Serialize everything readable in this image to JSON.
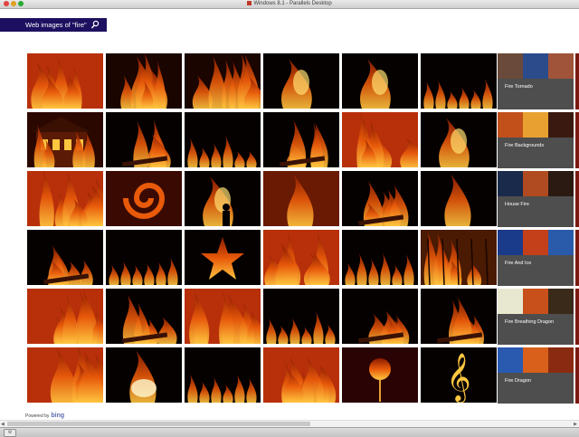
{
  "window": {
    "title": "Windows 8.1 - Parallels Desktop"
  },
  "search": {
    "query_label": "Web images of \"fire\""
  },
  "results": {
    "images": [
      {
        "theme": "flames-wide"
      },
      {
        "theme": "flame-burst"
      },
      {
        "theme": "flame-cloud"
      },
      {
        "theme": "fire-figure"
      },
      {
        "theme": "fire-hand"
      },
      {
        "theme": "flame-row"
      },
      {
        "theme": "house-fire"
      },
      {
        "theme": "bonfire-dark"
      },
      {
        "theme": "flame-row"
      },
      {
        "theme": "logs"
      },
      {
        "theme": "flames-wide"
      },
      {
        "theme": "fire-woman"
      },
      {
        "theme": "flames-wide"
      },
      {
        "theme": "swirl"
      },
      {
        "theme": "silhouette"
      },
      {
        "theme": "single-flame"
      },
      {
        "theme": "fireplace"
      },
      {
        "theme": "tall-flame"
      },
      {
        "theme": "campfire"
      },
      {
        "theme": "flame-row"
      },
      {
        "theme": "fire-star"
      },
      {
        "theme": "flames-wide"
      },
      {
        "theme": "flame-black"
      },
      {
        "theme": "forest-fire"
      },
      {
        "theme": "flames-wide"
      },
      {
        "theme": "embers"
      },
      {
        "theme": "flames-wide"
      },
      {
        "theme": "flame-low"
      },
      {
        "theme": "bonfire-dark"
      },
      {
        "theme": "embers"
      },
      {
        "theme": "flames-wide"
      },
      {
        "theme": "white-flame"
      },
      {
        "theme": "flame-low"
      },
      {
        "theme": "flames-wide"
      },
      {
        "theme": "fire-rose"
      },
      {
        "theme": "treble-clef"
      }
    ],
    "related": [
      {
        "label": "Fire Tornado",
        "colors": [
          "#6a4a3a",
          "#2b4b8a",
          "#a0543a"
        ]
      },
      {
        "label": "Fire Backgrounds",
        "colors": [
          "#c2501b",
          "#e8a030",
          "#3a1a10"
        ]
      },
      {
        "label": "House Fire",
        "colors": [
          "#1a2a4a",
          "#b04a20",
          "#2a1a12"
        ]
      },
      {
        "label": "Fire And Ice",
        "colors": [
          "#1a3a8a",
          "#c4401a",
          "#2a5aaa"
        ]
      },
      {
        "label": "Fire Breathing Dragon",
        "colors": [
          "#e8e8d0",
          "#c8501a",
          "#3a2a1a"
        ]
      },
      {
        "label": "Fire Dragon",
        "colors": [
          "#2a5ab0",
          "#d8601a",
          "#8a2a10"
        ]
      }
    ]
  },
  "footer": {
    "powered_by": "Powered by",
    "brand": "bing"
  },
  "colors": {
    "search_bg": "#1e1060",
    "related_bg": "#4e4e4e",
    "flame_dark": "#8a1a00",
    "flame_mid": "#e85a0a",
    "flame_light": "#ffc640"
  }
}
